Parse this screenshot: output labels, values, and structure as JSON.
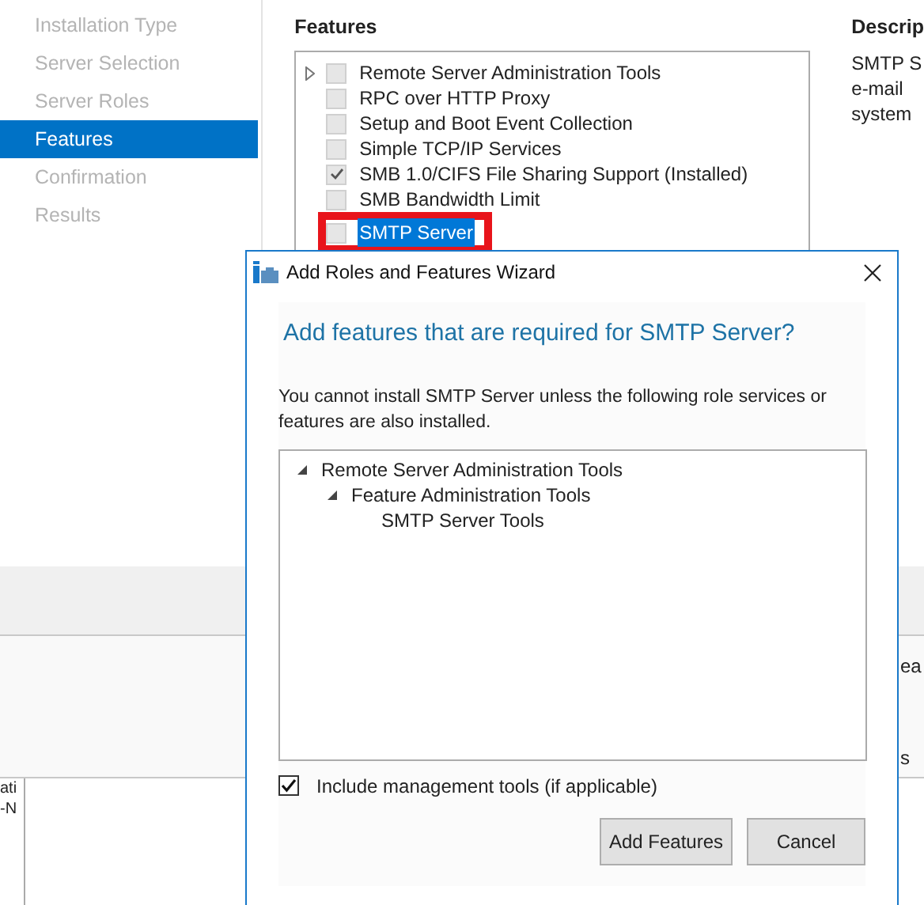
{
  "nav": {
    "items": [
      {
        "label": "Installation Type",
        "selected": false
      },
      {
        "label": "Server Selection",
        "selected": false
      },
      {
        "label": "Server Roles",
        "selected": false
      },
      {
        "label": "Features",
        "selected": true
      },
      {
        "label": "Confirmation",
        "selected": false
      },
      {
        "label": "Results",
        "selected": false
      }
    ]
  },
  "features": {
    "heading": "Features",
    "rows": [
      {
        "label": "Remote Server Administration Tools",
        "checked": false,
        "expandable": true,
        "selected": false
      },
      {
        "label": "RPC over HTTP Proxy",
        "checked": false,
        "expandable": false,
        "selected": false
      },
      {
        "label": "Setup and Boot Event Collection",
        "checked": false,
        "expandable": false,
        "selected": false
      },
      {
        "label": "Simple TCP/IP Services",
        "checked": false,
        "expandable": false,
        "selected": false
      },
      {
        "label": "SMB 1.0/CIFS File Sharing Support (Installed)",
        "checked": true,
        "expandable": false,
        "selected": false
      },
      {
        "label": "SMB Bandwidth Limit",
        "checked": false,
        "expandable": false,
        "selected": false
      },
      {
        "label": "SMTP Server",
        "checked": false,
        "expandable": false,
        "selected": true
      }
    ]
  },
  "description": {
    "heading": "Descrip",
    "lines": [
      "SMTP S",
      "e-mail",
      "system"
    ]
  },
  "right_fragments": [
    "ea",
    "s"
  ],
  "left_fragments": [
    "ati",
    "-N"
  ],
  "dialog": {
    "title": "Add Roles and Features Wizard",
    "heading": "Add features that are required for SMTP Server?",
    "message": "You cannot install SMTP Server unless the following role services or features are also installed.",
    "tree": [
      {
        "label": "Remote Server Administration Tools",
        "expanded": true,
        "children": [
          {
            "label": "Feature Administration Tools",
            "expanded": true,
            "children": [
              {
                "label": "SMTP Server Tools"
              }
            ]
          }
        ]
      }
    ],
    "include_tools": {
      "label": "Include management tools (if applicable)",
      "checked": true
    },
    "buttons": [
      "Add Features",
      "Cancel"
    ]
  }
}
